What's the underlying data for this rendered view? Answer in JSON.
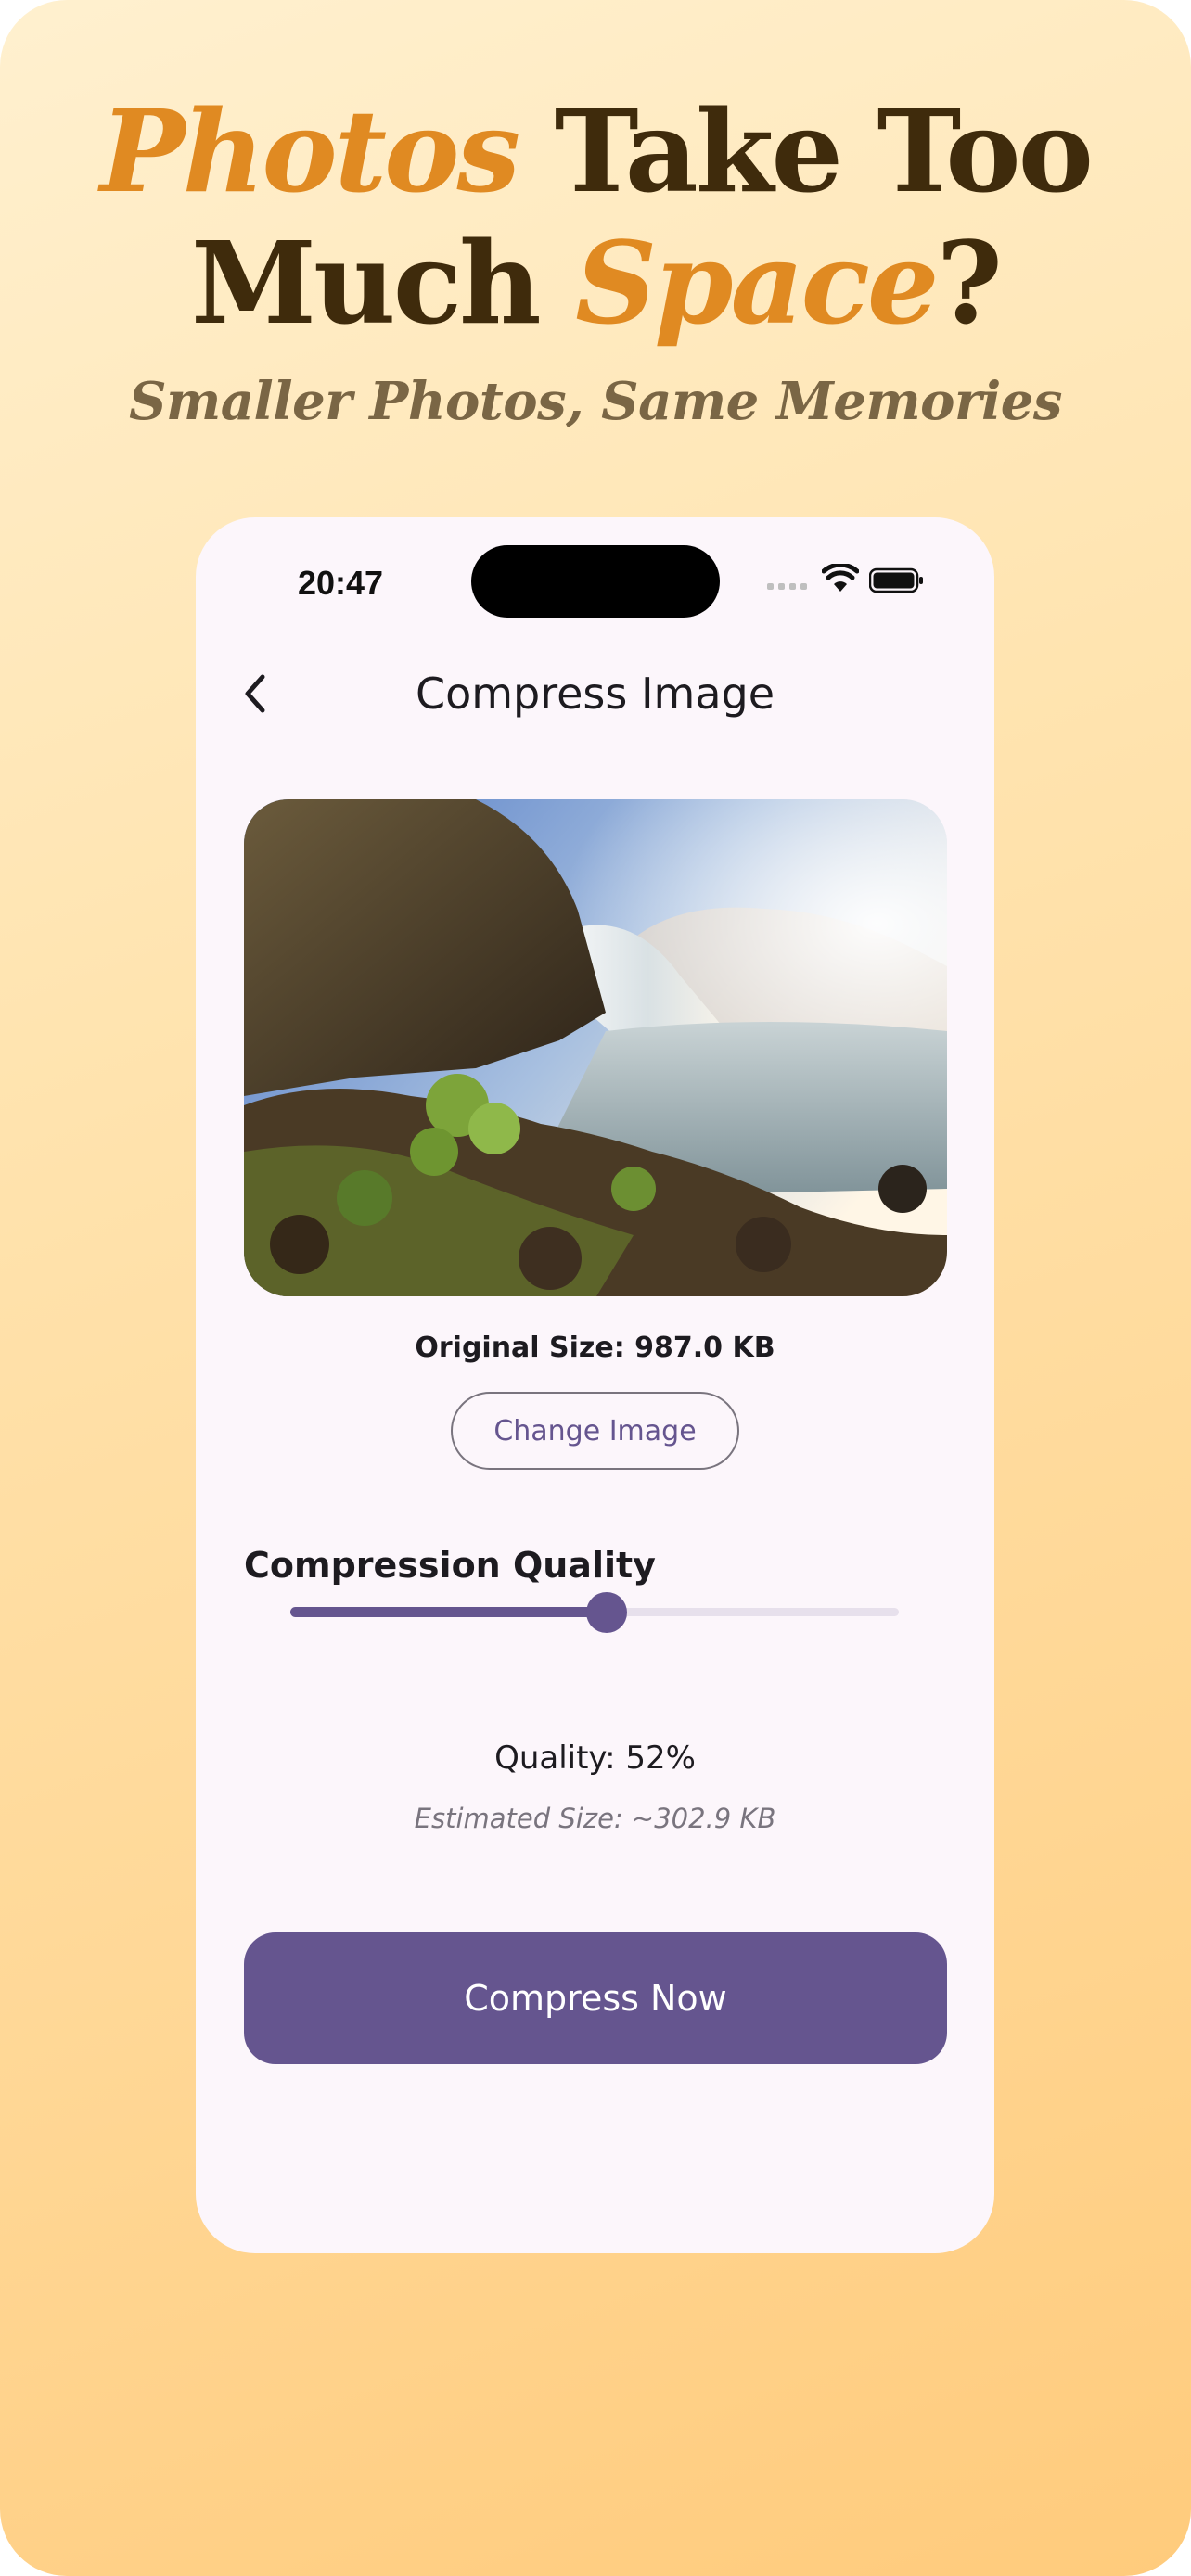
{
  "headline": {
    "line1_accent": "Photos",
    "line1_rest": " Take Too",
    "line2_start": "Much ",
    "line2_accent": "Space",
    "line2_end": "?"
  },
  "subheadline": "Smaller Photos, Same Memories",
  "status_bar": {
    "time": "20:47"
  },
  "nav": {
    "back_icon": "chevron-left-icon",
    "title": "Compress Image"
  },
  "image_info": {
    "original_size": "Original Size: 987.0 KB"
  },
  "change_image_button": "Change Image",
  "compression": {
    "section_title": "Compression Quality",
    "slider_value": 0.52,
    "quality_label": "Quality: 52%",
    "estimated_size": "Estimated Size: ~302.9 KB"
  },
  "compress_button": "Compress Now",
  "colors": {
    "accent_orange": "#e08a22",
    "headline_brown": "#3f2b0c",
    "primary_purple": "#65558f",
    "screen_background": "#fcf6fb"
  }
}
